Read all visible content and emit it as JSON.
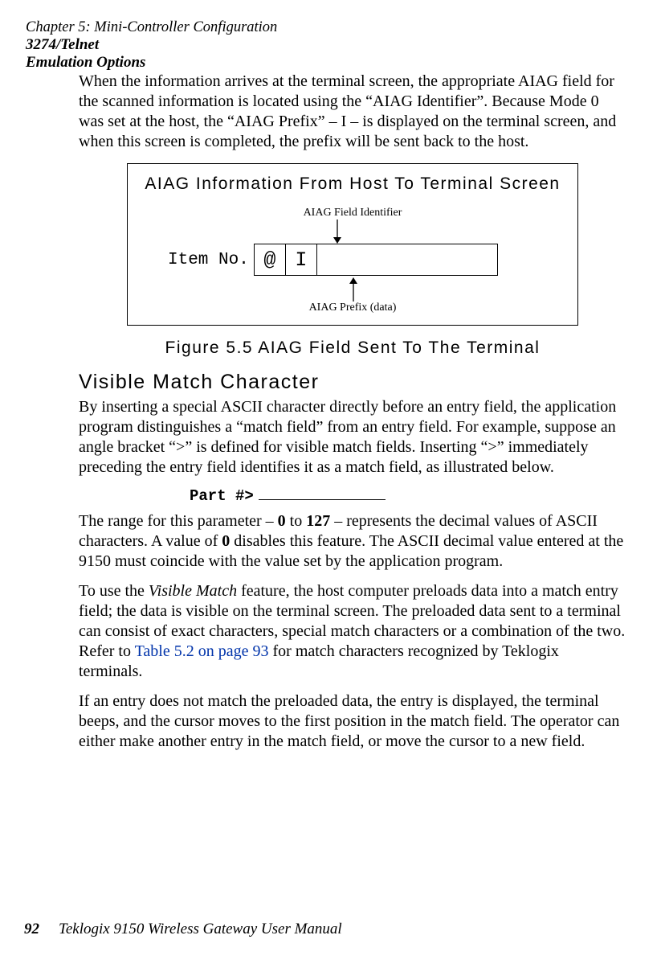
{
  "running_head": {
    "chapter": "Chapter 5:  Mini-Controller Configuration",
    "section_line1": "3274/Telnet",
    "section_line2": "Emulation Options"
  },
  "paragraphs": {
    "p1": "When the information arrives at the terminal screen, the appropriate AIAG field for the scanned information is located using the “AIAG Identifier”. Because Mode 0 was set at the host, the “AIAG Prefix” – I – is displayed on the terminal screen, and when this screen is completed, the prefix will be sent back to the host.",
    "p2a": "By inserting a special ASCII character directly before an entry field, the application program distinguishes a “match field” from an entry field. For example, suppose an angle bracket “>” is defined for visible match fields. Inserting “>” immediately preceding the entry field identifies it as a match field, as illustrated below.",
    "p3_part1": "The range for this parameter – ",
    "p3_b1": "0",
    "p3_mid1": " to ",
    "p3_b2": "127",
    "p3_mid2": " – represents the decimal values of ASCII characters. A value of ",
    "p3_b3": "0",
    "p3_part2": " disables this feature. The ASCII decimal value entered at the 9150 must coincide with the value set by the application program.",
    "p4_part1": "To use the ",
    "p4_i1": "Visible Match",
    "p4_part2": " feature, the host computer preloads data into a match entry field; the data is visible on the terminal screen. The preloaded data sent to a terminal can consist of exact characters, special match characters or a combination of the two. Refer to ",
    "p4_link": "Table 5.2 on page 93",
    "p4_part3": " for match characters recognized by Teklogix terminals.",
    "p5": "If an entry does not match the preloaded data, the entry is displayed, the terminal beeps, and the cursor moves to the first position in the match field. The operator can either make another entry in the match field, or move the cursor to a new field."
  },
  "figure": {
    "box_title": "AIAG Information From Host To Terminal Screen",
    "top_label": "AIAG Field Identifier",
    "item_label": "Item No.",
    "at_char": "@",
    "prefix_char": "I",
    "bottom_label": "AIAG Prefix (data)",
    "caption": "Figure 5.5 AIAG Field Sent To The Terminal"
  },
  "subhead": "Visible Match Character",
  "code_line": "Part #>",
  "footer": {
    "page_number": "92",
    "manual": "Teklogix 9150 Wireless Gateway User Manual"
  }
}
